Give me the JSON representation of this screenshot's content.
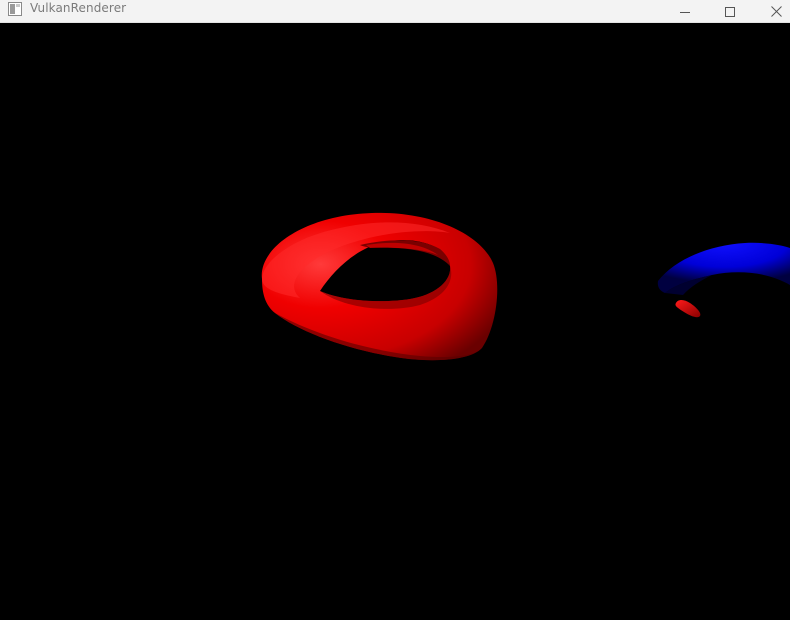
{
  "window": {
    "title": "VulkanRenderer",
    "icon": "app-window-icon",
    "controls": {
      "minimize_icon": "minimize-icon",
      "maximize_icon": "maximize-icon",
      "close_icon": "close-icon"
    }
  },
  "scene": {
    "background_color": "#000000",
    "objects": [
      {
        "name": "red-torus",
        "color": "#ff0000"
      },
      {
        "name": "blue-torus",
        "color": "#0000ff"
      },
      {
        "name": "small-red-object",
        "color": "#ff0000"
      }
    ]
  }
}
